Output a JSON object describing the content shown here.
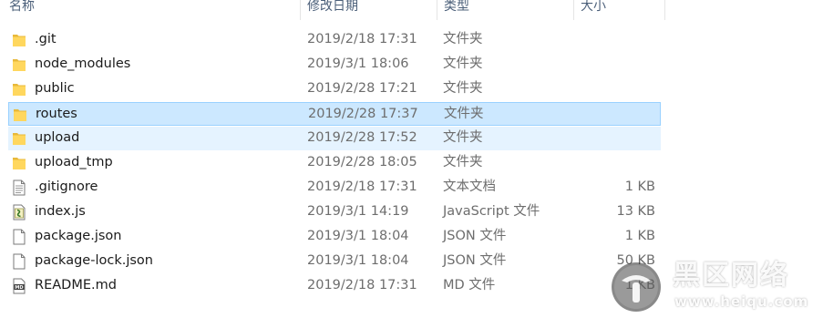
{
  "columns": {
    "name": "名称",
    "date": "修改日期",
    "type": "类型",
    "size": "大小"
  },
  "files": [
    {
      "name": ".git",
      "date": "2019/2/18 17:31",
      "type": "文件夹",
      "size": "",
      "icon": "folder-icon",
      "state": "normal"
    },
    {
      "name": "node_modules",
      "date": "2019/3/1 18:06",
      "type": "文件夹",
      "size": "",
      "icon": "folder-icon",
      "state": "normal"
    },
    {
      "name": "public",
      "date": "2019/2/28 17:21",
      "type": "文件夹",
      "size": "",
      "icon": "folder-icon",
      "state": "normal"
    },
    {
      "name": "routes",
      "date": "2019/2/28 17:37",
      "type": "文件夹",
      "size": "",
      "icon": "folder-icon",
      "state": "selected"
    },
    {
      "name": "upload",
      "date": "2019/2/28 17:52",
      "type": "文件夹",
      "size": "",
      "icon": "folder-icon",
      "state": "hover"
    },
    {
      "name": "upload_tmp",
      "date": "2019/2/28 18:05",
      "type": "文件夹",
      "size": "",
      "icon": "folder-icon",
      "state": "normal"
    },
    {
      "name": ".gitignore",
      "date": "2019/2/18 17:31",
      "type": "文本文档",
      "size": "1 KB",
      "icon": "text-file-icon",
      "state": "normal"
    },
    {
      "name": "index.js",
      "date": "2019/3/1 14:19",
      "type": "JavaScript 文件",
      "size": "13 KB",
      "icon": "javascript-file-icon",
      "state": "normal"
    },
    {
      "name": "package.json",
      "date": "2019/3/1 18:04",
      "type": "JSON 文件",
      "size": "1 KB",
      "icon": "blank-file-icon",
      "state": "normal"
    },
    {
      "name": "package-lock.json",
      "date": "2019/3/1 18:04",
      "type": "JSON 文件",
      "size": "50 KB",
      "icon": "blank-file-icon",
      "state": "normal"
    },
    {
      "name": "README.md",
      "date": "2019/2/18 17:31",
      "type": "MD 文件",
      "size": "1 KB",
      "icon": "markdown-file-icon",
      "state": "normal"
    }
  ],
  "watermark": {
    "title": "黑区网络",
    "url": "www.heiqu.com"
  },
  "colors": {
    "selected_bg": "#cce8ff",
    "selected_border": "#99d1ff",
    "hover_bg": "#e5f3ff",
    "folder": "#ffd75e",
    "header_text": "#4c607a"
  }
}
